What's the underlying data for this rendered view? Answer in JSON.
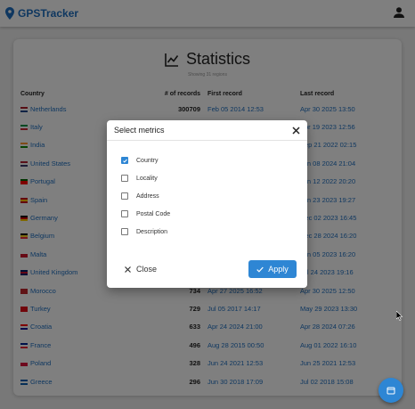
{
  "app": {
    "name": "GPSTracker"
  },
  "stats": {
    "title": "Statistics",
    "subtitle": "Showing 31 regions",
    "columns": [
      "Country",
      "# of records",
      "First record",
      "Last record"
    ],
    "rows": [
      {
        "country": "Netherlands",
        "count": "300709",
        "first": "Feb 05 2014 12:53",
        "last": "Apr 30 2025 13:50",
        "flag": [
          "#ae1c28",
          "#ffffff",
          "#21468b"
        ]
      },
      {
        "country": "Italy",
        "count": "",
        "first": "",
        "last": "Apr 19 2023 12:56",
        "flag": [
          "#009246",
          "#ffffff",
          "#ce2b37"
        ]
      },
      {
        "country": "India",
        "count": "",
        "first": "",
        "last": "Sep 21 2022 02:15",
        "flag": [
          "#ff9933",
          "#ffffff",
          "#138808"
        ]
      },
      {
        "country": "United States",
        "count": "",
        "first": "",
        "last": "Jun 08 2024 21:04",
        "flag": [
          "#b22234",
          "#ffffff",
          "#3c3b6e"
        ]
      },
      {
        "country": "Portugal",
        "count": "",
        "first": "",
        "last": "Jun 12 2022 20:20",
        "flag": [
          "#006600",
          "#ff0000",
          "#ff0000"
        ]
      },
      {
        "country": "Spain",
        "count": "",
        "first": "",
        "last": "Jun 23 2023 19:27",
        "flag": [
          "#c60b1e",
          "#ffc400",
          "#c60b1e"
        ]
      },
      {
        "country": "Germany",
        "count": "",
        "first": "",
        "last": "Dec 02 2023 16:45",
        "flag": [
          "#000000",
          "#dd0000",
          "#ffce00"
        ]
      },
      {
        "country": "Belgium",
        "count": "",
        "first": "",
        "last": "Dec 28 2024 16:20",
        "flag": [
          "#000000",
          "#fdda24",
          "#ef3340"
        ]
      },
      {
        "country": "Malta",
        "count": "",
        "first": "",
        "last": "Jun 05 2023 16:20",
        "flag": [
          "#ffffff",
          "#cf142b",
          "#cf142b"
        ]
      },
      {
        "country": "United Kingdom",
        "count": "",
        "first": "",
        "last": "Jul 24 2023 19:16",
        "flag": [
          "#012169",
          "#c8102e",
          "#012169"
        ]
      },
      {
        "country": "Morocco",
        "count": "734",
        "first": "Apr 27 2025 16:52",
        "last": "Apr 30 2025 12:50",
        "flag": [
          "#c1272d",
          "#c1272d",
          "#c1272d"
        ]
      },
      {
        "country": "Turkey",
        "count": "729",
        "first": "Jul 05 2017 14:17",
        "last": "May 29 2023 13:30",
        "flag": [
          "#e30a17",
          "#e30a17",
          "#e30a17"
        ]
      },
      {
        "country": "Croatia",
        "count": "633",
        "first": "Apr 24 2024 21:00",
        "last": "Apr 28 2024 07:26",
        "flag": [
          "#ff0000",
          "#ffffff",
          "#171796"
        ]
      },
      {
        "country": "France",
        "count": "496",
        "first": "Aug 28 2015 00:50",
        "last": "Aug 01 2022 16:10",
        "flag": [
          "#002395",
          "#ffffff",
          "#ed2939"
        ]
      },
      {
        "country": "Poland",
        "count": "328",
        "first": "Jun 24 2021 12:53",
        "last": "Jun 25 2021 12:53",
        "flag": [
          "#ffffff",
          "#dc143c",
          "#dc143c"
        ]
      },
      {
        "country": "Greece",
        "count": "296",
        "first": "Jun 30 2018 17:09",
        "last": "Jul 02 2018 15:08",
        "flag": [
          "#0d5eaf",
          "#ffffff",
          "#0d5eaf"
        ]
      }
    ]
  },
  "modal": {
    "title": "Select metrics",
    "options": [
      {
        "label": "Country",
        "checked": true
      },
      {
        "label": "Locality",
        "checked": false
      },
      {
        "label": "Address",
        "checked": false
      },
      {
        "label": "Postal Code",
        "checked": false
      },
      {
        "label": "Description",
        "checked": false
      }
    ],
    "close_label": "Close",
    "apply_label": "Apply"
  },
  "colors": {
    "accent": "#2e86d4",
    "link": "#1e6fc0",
    "overlay": "rgba(0,0,0,0.5)"
  },
  "icons": {
    "brand": "map-pin-icon",
    "user": "user-icon",
    "title": "line-chart-icon",
    "fab": "calendar-icon"
  }
}
